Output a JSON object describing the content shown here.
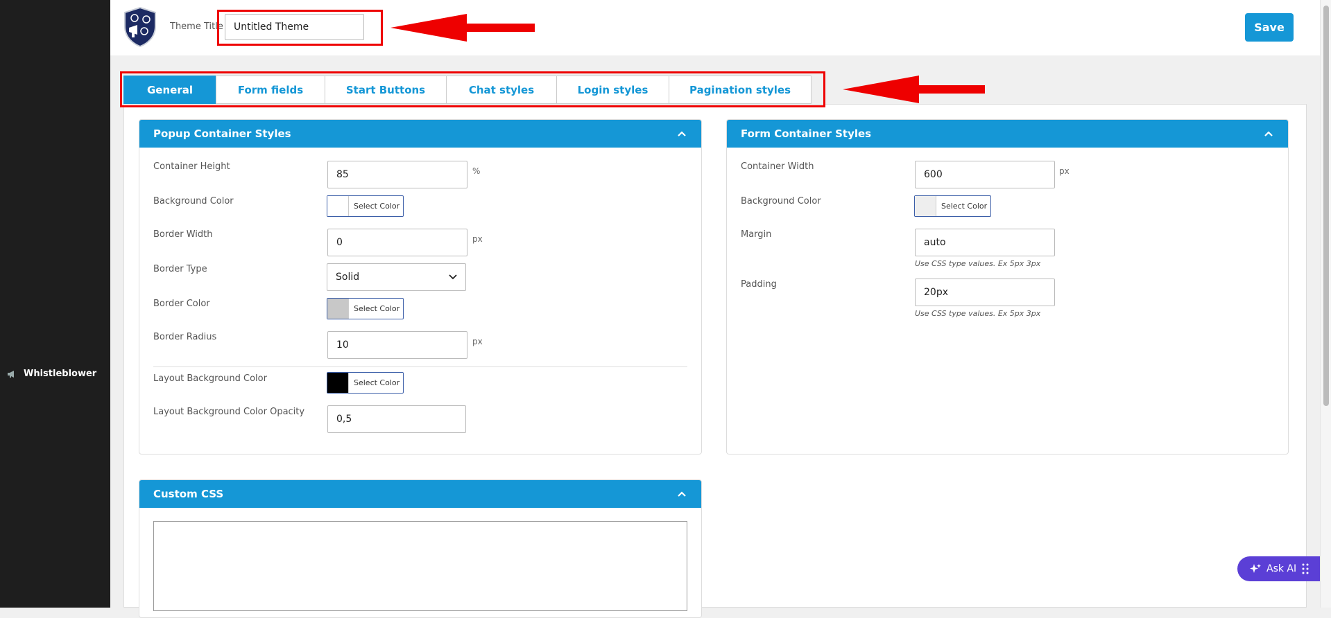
{
  "sidebar": {
    "items": [
      {
        "label": "Whistleblower",
        "icon": "megaphone-icon"
      }
    ]
  },
  "header": {
    "theme_title_label": "Theme Title",
    "theme_title_value": "Untitled Theme",
    "save_label": "Save"
  },
  "tabs": [
    "General",
    "Form fields",
    "Start Buttons",
    "Chat styles",
    "Login styles",
    "Pagination styles"
  ],
  "active_tab": "General",
  "popup_panel": {
    "title": "Popup Container Styles",
    "container_height": {
      "label": "Container Height",
      "value": "85",
      "unit": "%"
    },
    "background_color": {
      "label": "Background Color",
      "button": "Select Color",
      "swatch": "#ffffff"
    },
    "border_width": {
      "label": "Border Width",
      "value": "0",
      "unit": "px"
    },
    "border_type": {
      "label": "Border Type",
      "value": "Solid"
    },
    "border_color": {
      "label": "Border Color",
      "button": "Select Color",
      "swatch": "#c8c8c8"
    },
    "border_radius": {
      "label": "Border Radius",
      "value": "10",
      "unit": "px"
    },
    "layout_bg_color": {
      "label": "Layout Background Color",
      "button": "Select Color",
      "swatch": "#000000"
    },
    "layout_bg_opacity": {
      "label": "Layout Background Color Opacity",
      "value": "0,5"
    }
  },
  "form_panel": {
    "title": "Form Container Styles",
    "container_width": {
      "label": "Container Width",
      "value": "600",
      "unit": "px"
    },
    "background_color": {
      "label": "Background Color",
      "button": "Select Color",
      "swatch": "#eeeeee"
    },
    "margin": {
      "label": "Margin",
      "value": "auto",
      "hint": "Use CSS type values. Ex 5px 3px"
    },
    "padding": {
      "label": "Padding",
      "value": "20px",
      "hint": "Use CSS type values. Ex 5px 3px"
    }
  },
  "css_panel": {
    "title": "Custom CSS",
    "value": ""
  },
  "ask_ai": {
    "label": "Ask AI"
  },
  "colors": {
    "accent": "#1597d6",
    "sidebar": "#1e1e1e",
    "annotation": "#ee0000",
    "ask_ai": "#5b3fd6"
  }
}
